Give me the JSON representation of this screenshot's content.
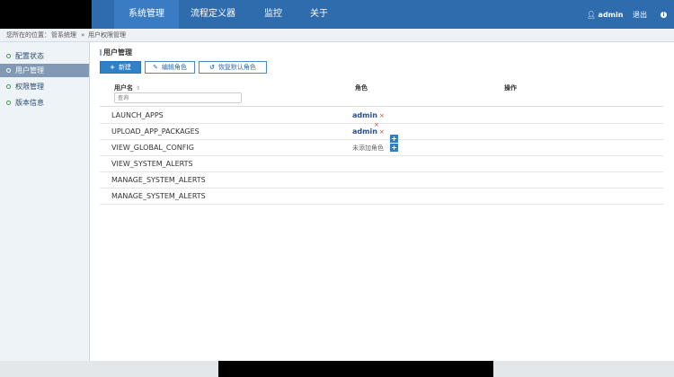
{
  "nav": {
    "items": [
      {
        "label": "系统管理",
        "active": true
      },
      {
        "label": "流程定义器",
        "active": false
      },
      {
        "label": "监控",
        "active": false
      },
      {
        "label": "关于",
        "active": false
      }
    ],
    "user": "admin",
    "logout": "退出",
    "user_icon": "user-icon",
    "info_icon": "info-icon"
  },
  "breadcrumb": {
    "prefix": "您所在的位置：",
    "root": "管系统理",
    "sep": "»",
    "current": "用户权限管理"
  },
  "sidebar": {
    "items": [
      {
        "label": "配置状态",
        "active": false
      },
      {
        "label": "用户管理",
        "active": true
      },
      {
        "label": "权限管理",
        "active": false
      },
      {
        "label": "版本信息",
        "active": false
      }
    ]
  },
  "main": {
    "title": "用户管理",
    "buttons": {
      "new": "新建",
      "edit_role": "编辑角色",
      "restore_default": "恢复默认角色"
    },
    "columns": {
      "username": "用户名",
      "role": "角色",
      "action": "操作"
    },
    "filter_placeholder": "查询",
    "rows": [
      {
        "name": "LAUNCH_APPS",
        "roles": [
          "admin"
        ]
      },
      {
        "name": "UPLOAD_APP_PACKAGES",
        "roles": [
          "admin"
        ]
      },
      {
        "name": "VIEW_GLOBAL_CONFIG",
        "roles": [],
        "no_role_text": "未添加角色"
      },
      {
        "name": "VIEW_SYSTEM_ALERTS",
        "roles": []
      },
      {
        "name": "MANAGE_SYSTEM_ALERTS",
        "roles": []
      },
      {
        "name": "MANAGE_SYSTEM_ALERTS",
        "roles": []
      }
    ]
  },
  "colors": {
    "topbar": "#2f6cae",
    "active_nav": "#3a7cc4",
    "sidebar_active": "#8199b4",
    "primary_button": "#2f80c7",
    "remove_x": "#d0342c"
  }
}
